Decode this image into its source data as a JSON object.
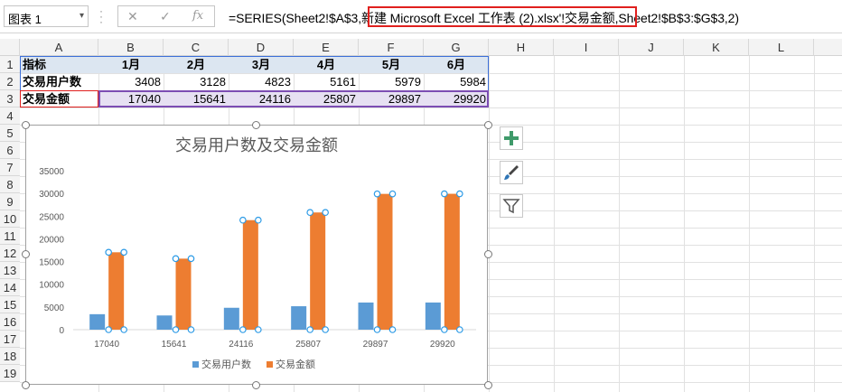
{
  "formula_bar": {
    "name_box": "图表 1",
    "cancel_icon": "✕",
    "enter_icon": "✓",
    "fx_label": "fx",
    "formula_prefix": "=SERIES(Sheet2!$A$3,",
    "formula_highlight": "新建 Microsoft Excel 工作表 (2).xlsx'!交易金额",
    "formula_suffix": ",Sheet2!$B$3:$G$3,2)"
  },
  "columns": [
    "A",
    "B",
    "C",
    "D",
    "E",
    "F",
    "G",
    "H",
    "I",
    "J",
    "K",
    "L"
  ],
  "rows": [
    "1",
    "2",
    "3",
    "4",
    "5",
    "6",
    "7",
    "8",
    "9",
    "10",
    "11",
    "12",
    "13",
    "14",
    "15",
    "16",
    "17",
    "18",
    "19"
  ],
  "table": {
    "header": [
      "指标",
      "1月",
      "2月",
      "3月",
      "4月",
      "5月",
      "6月"
    ],
    "rows": [
      {
        "label": "交易用户数",
        "values": [
          "3408",
          "3128",
          "4823",
          "5161",
          "5979",
          "5984"
        ]
      },
      {
        "label": "交易金额",
        "values": [
          "17040",
          "15641",
          "24116",
          "25807",
          "29897",
          "29920"
        ]
      }
    ]
  },
  "chart_data": {
    "type": "bar",
    "title": "交易用户数及交易金额",
    "categories": [
      "17040",
      "15641",
      "24116",
      "25807",
      "29897",
      "29920"
    ],
    "series": [
      {
        "name": "交易用户数",
        "values": [
          3408,
          3128,
          4823,
          5161,
          5979,
          5984
        ],
        "color": "#5b9bd5"
      },
      {
        "name": "交易金额",
        "values": [
          17040,
          15641,
          24116,
          25807,
          29897,
          29920
        ],
        "color": "#ed7d31"
      }
    ],
    "ylim": [
      0,
      35000
    ],
    "yticks": [
      "0",
      "5000",
      "10000",
      "15000",
      "20000",
      "25000",
      "30000",
      "35000"
    ],
    "legend_position": "bottom",
    "grid": false
  },
  "side_buttons": [
    "plus-icon",
    "brush-icon",
    "filter-icon"
  ],
  "colors": {
    "header_fill": "#dce6f1",
    "selection_blue": "#3c6fd8",
    "selection_purple": "#7c4db3",
    "row3_fill": "#e6e0f2",
    "highlight_red": "#e0201e"
  }
}
